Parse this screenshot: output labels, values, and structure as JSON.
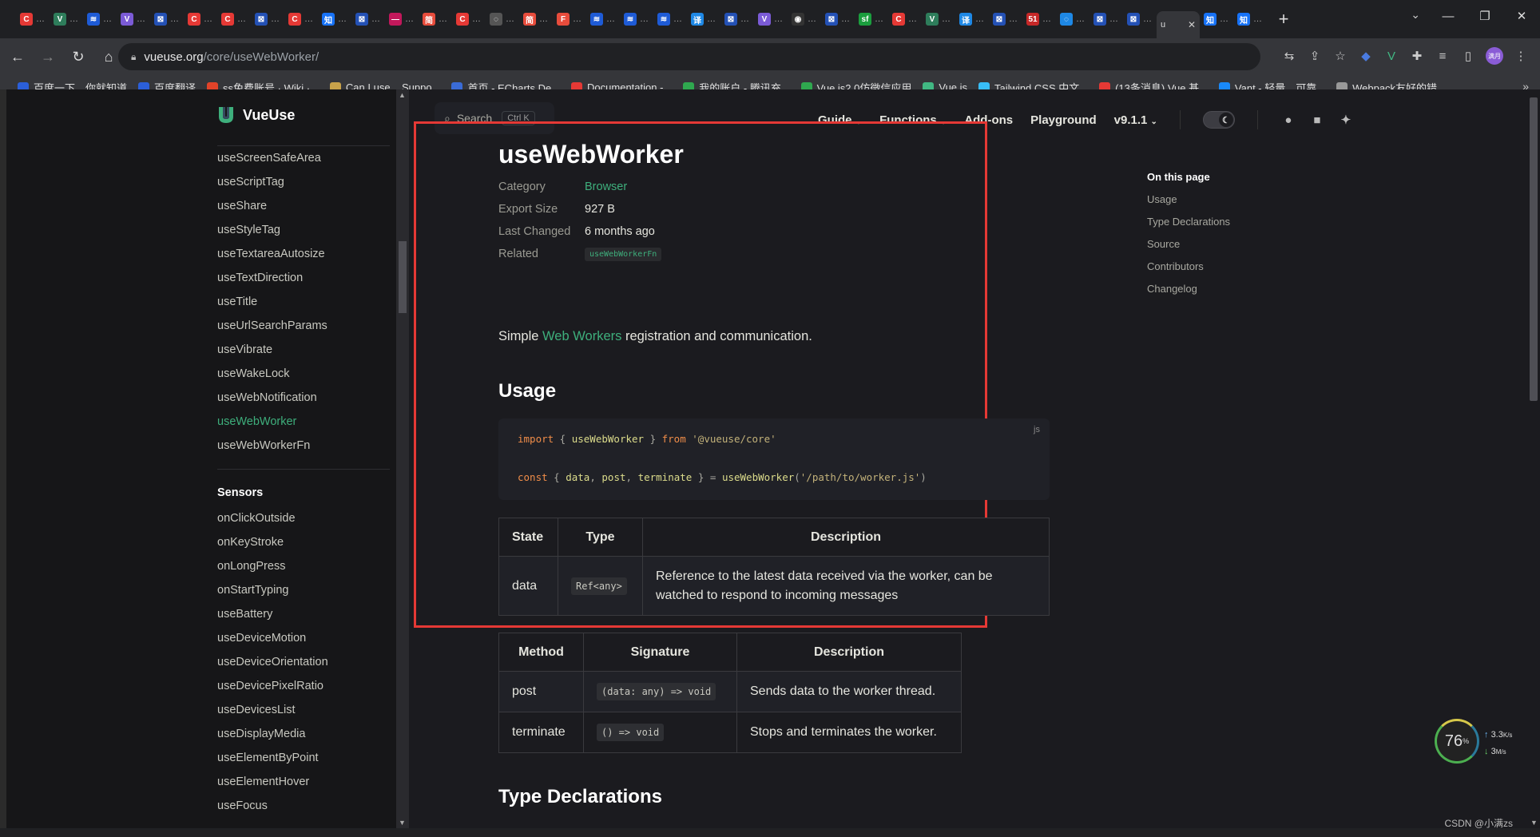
{
  "browser": {
    "tabs": [
      {
        "icon": "C",
        "color": "#e53935"
      },
      {
        "icon": "V",
        "color": "#2e7d5b"
      },
      {
        "icon": "≋",
        "color": "#1e5bd6"
      },
      {
        "icon": "V",
        "color": "#7b5bd6"
      },
      {
        "icon": "⊠",
        "color": "#2451b5"
      },
      {
        "icon": "C",
        "color": "#e53935"
      },
      {
        "icon": "C",
        "color": "#e53935"
      },
      {
        "icon": "⊠",
        "color": "#2451b5"
      },
      {
        "icon": "C",
        "color": "#e53935"
      },
      {
        "icon": "知",
        "color": "#1772f6"
      },
      {
        "icon": "⊠",
        "color": "#2451b5"
      },
      {
        "icon": "—",
        "color": "#c2185b"
      },
      {
        "icon": "简",
        "color": "#e74c3c"
      },
      {
        "icon": "C",
        "color": "#e53935"
      },
      {
        "icon": "◌",
        "color": "#555"
      },
      {
        "icon": "简",
        "color": "#e74c3c"
      },
      {
        "icon": "F",
        "color": "#e74c3c"
      },
      {
        "icon": "≋",
        "color": "#1e5bd6"
      },
      {
        "icon": "≋",
        "color": "#1e5bd6"
      },
      {
        "icon": "≋",
        "color": "#1e5bd6"
      },
      {
        "icon": "译",
        "color": "#1e88e5"
      },
      {
        "icon": "⊠",
        "color": "#2451b5"
      },
      {
        "icon": "V",
        "color": "#7b5bd6"
      },
      {
        "icon": "◉",
        "color": "#333"
      },
      {
        "icon": "⊠",
        "color": "#2451b5"
      },
      {
        "icon": "sf",
        "color": "#1b9e3e"
      },
      {
        "icon": "C",
        "color": "#e53935"
      },
      {
        "icon": "V",
        "color": "#2e7d5b"
      },
      {
        "icon": "译",
        "color": "#1e88e5"
      },
      {
        "icon": "⊠",
        "color": "#2451b5"
      },
      {
        "icon": "51",
        "color": "#c62828"
      },
      {
        "icon": "◌",
        "color": "#1e88e5"
      },
      {
        "icon": "⊠",
        "color": "#2451b5"
      },
      {
        "icon": "⊠",
        "color": "#2451b5"
      }
    ],
    "active_tab": {
      "icon": "u",
      "label": "u"
    },
    "tabs_after": [
      {
        "icon": "知",
        "color": "#1772f6"
      },
      {
        "icon": "知",
        "color": "#1772f6"
      }
    ],
    "new_tab": "+",
    "url_host": "vueuse.org",
    "url_path": "/core/useWebWorker/",
    "window": {
      "minimize": "—",
      "restore": "❐",
      "close": "✕"
    },
    "bookmarks": [
      {
        "label": "百度一下，你就知道",
        "color": "#2b5fd9"
      },
      {
        "label": "百度翻译",
        "color": "#2b5fd9"
      },
      {
        "label": "ss免费账号 · Wiki ·...",
        "color": "#e24329"
      },
      {
        "label": "Can I use... Suppo...",
        "color": "#c8a24a"
      },
      {
        "label": "首页 - ECharts De...",
        "color": "#3a6bd6"
      },
      {
        "label": "Documentation -...",
        "color": "#e53935"
      },
      {
        "label": "我的账户 - 腾讯充...",
        "color": "#2fa84f"
      },
      {
        "label": "Vue.js2.0仿微信应用",
        "color": "#2fa84f"
      },
      {
        "label": "Vue.js",
        "color": "#41b883"
      },
      {
        "label": "Tailwind CSS 中文...",
        "color": "#38bdf8"
      },
      {
        "label": "(13条消息) Vue 基...",
        "color": "#e53935"
      },
      {
        "label": "Vant - 轻量、可靠...",
        "color": "#1989fa"
      },
      {
        "label": "Webpack友好的错...",
        "color": "#999"
      }
    ],
    "bookmarks_more": "»"
  },
  "site": {
    "brand": "VueUse",
    "search_label": "Search",
    "search_kbd": "Ctrl K",
    "nav": {
      "guide": "Guide",
      "functions": "Functions",
      "addons": "Add-ons",
      "playground": "Playground",
      "version": "v9.1.1"
    }
  },
  "sidebar": {
    "items_top": [
      "useScreenSafeArea",
      "useScriptTag",
      "useShare",
      "useStyleTag",
      "useTextareaAutosize",
      "useTextDirection",
      "useTitle",
      "useUrlSearchParams",
      "useVibrate",
      "useWakeLock",
      "useWebNotification",
      "useWebWorker",
      "useWebWorkerFn"
    ],
    "active": "useWebWorker",
    "section": "Sensors",
    "items_sensors": [
      "onClickOutside",
      "onKeyStroke",
      "onLongPress",
      "onStartTyping",
      "useBattery",
      "useDeviceMotion",
      "useDeviceOrientation",
      "useDevicePixelRatio",
      "useDevicesList",
      "useDisplayMedia",
      "useElementByPoint",
      "useElementHover",
      "useFocus"
    ]
  },
  "doc": {
    "title": "useWebWorker",
    "meta": {
      "category_label": "Category",
      "category_value": "Browser",
      "size_label": "Export Size",
      "size_value": "927 B",
      "changed_label": "Last Changed",
      "changed_value": "6 months ago",
      "related_label": "Related",
      "related_value": "useWebWorkerFn"
    },
    "desc_pre": "Simple ",
    "desc_link": "Web Workers",
    "desc_post": " registration and communication.",
    "usage_heading": "Usage",
    "code_lang": "js",
    "code": {
      "l1": [
        {
          "t": "import",
          "c": "kw"
        },
        {
          "t": " { ",
          "c": "pun"
        },
        {
          "t": "useWebWorker",
          "c": "fn"
        },
        {
          "t": " } ",
          "c": "pun"
        },
        {
          "t": "from",
          "c": "kw"
        },
        {
          "t": " ",
          "c": "pun"
        },
        {
          "t": "'@vueuse/core'",
          "c": "str"
        }
      ],
      "l2": [
        {
          "t": "const",
          "c": "kw"
        },
        {
          "t": " { ",
          "c": "pun"
        },
        {
          "t": "data",
          "c": "fn"
        },
        {
          "t": ", ",
          "c": "pun"
        },
        {
          "t": "post",
          "c": "fn"
        },
        {
          "t": ", ",
          "c": "pun"
        },
        {
          "t": "terminate",
          "c": "fn"
        },
        {
          "t": " } = ",
          "c": "pun"
        },
        {
          "t": "useWebWorker",
          "c": "fn"
        },
        {
          "t": "(",
          "c": "pun"
        },
        {
          "t": "'/path/to/worker.js'",
          "c": "str"
        },
        {
          "t": ")",
          "c": "pun"
        }
      ]
    },
    "state_table": {
      "headers": [
        "State",
        "Type",
        "Description"
      ],
      "rows": [
        [
          "data",
          "Ref<any>",
          "Reference to the latest data received via the worker, can be watched to respond to incoming messages"
        ]
      ]
    },
    "method_table": {
      "headers": [
        "Method",
        "Signature",
        "Description"
      ],
      "rows": [
        [
          "post",
          "(data: any) => void",
          "Sends data to the worker thread."
        ],
        [
          "terminate",
          "() => void",
          "Stops and terminates the worker."
        ]
      ]
    },
    "type_heading": "Type Declarations"
  },
  "toc": {
    "title": "On this page",
    "items": [
      "Usage",
      "Type Declarations",
      "Source",
      "Contributors",
      "Changelog"
    ]
  },
  "widget": {
    "percent": "76",
    "unit": "%",
    "up": "3.3",
    "up_unit": "K/s",
    "down": "3",
    "down_unit": "M/s"
  },
  "watermark": "CSDN @小满zs"
}
